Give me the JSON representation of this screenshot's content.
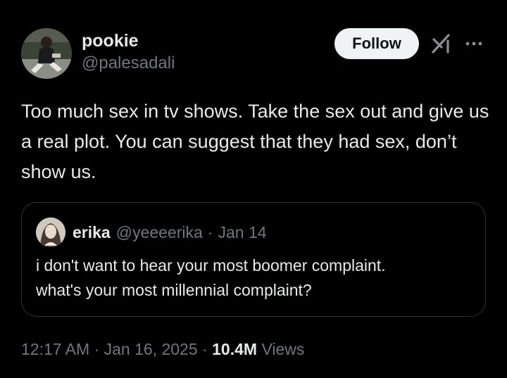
{
  "author": {
    "display_name": "pookie",
    "handle": "@palesadali"
  },
  "actions": {
    "follow_label": "Follow"
  },
  "icons": {
    "grok": "grok-icon",
    "more": "more-options-icon"
  },
  "tweet": {
    "text": "Too much sex in tv shows. Take the sex out and give us a real plot. You can suggest that they had sex, don’t show us."
  },
  "quote": {
    "display_name": "erika",
    "handle": "@yeeeerika",
    "separator": "·",
    "date": "Jan 14",
    "text_line1": "i don't want to hear your most boomer complaint.",
    "text_line2": "what's your most millennial complaint?"
  },
  "meta": {
    "time": "12:17 AM",
    "dot1": "·",
    "date": "Jan 16, 2025",
    "dot2": "·",
    "views_count": "10.4M",
    "views_label": "Views"
  },
  "colors": {
    "background": "#000000",
    "text_primary": "#e7e9ea",
    "text_secondary": "#71767b",
    "follow_bg": "#eff3f4",
    "border": "#2f3336"
  }
}
